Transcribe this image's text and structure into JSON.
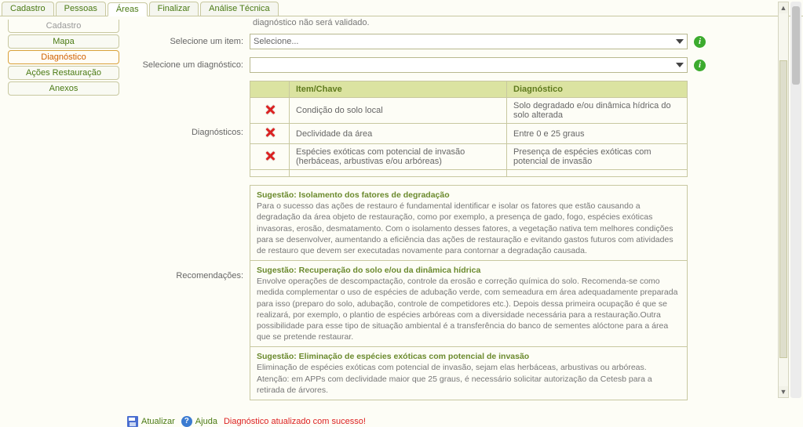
{
  "tabs": [
    {
      "label": "Cadastro",
      "active": false
    },
    {
      "label": "Pessoas",
      "active": false
    },
    {
      "label": "Áreas",
      "active": true
    },
    {
      "label": "Finalizar",
      "active": false
    },
    {
      "label": "Análise Técnica",
      "active": false
    }
  ],
  "sidebar": [
    {
      "label": "Cadastro",
      "state": "dim"
    },
    {
      "label": "Mapa",
      "state": ""
    },
    {
      "label": "Diagnóstico",
      "state": "active"
    },
    {
      "label": "Ações Restauração",
      "state": ""
    },
    {
      "label": "Anexos",
      "state": ""
    }
  ],
  "warning_suffix": "diagnóstico não será validado.",
  "labels": {
    "sel_item": "Selecione um item:",
    "sel_diag": "Selecione um diagnóstico:",
    "diagnosticos": "Diagnósticos:",
    "recomendacoes": "Recomendações:"
  },
  "select_item_value": "Selecione...",
  "select_diag_value": "",
  "diag_headers": {
    "col1": "",
    "col2": "Item/Chave",
    "col3": "Diagnóstico"
  },
  "diag_rows": [
    {
      "item": "Condição do solo local",
      "diag": "Solo degradado e/ou dinâmica hídrica do solo alterada"
    },
    {
      "item": "Declividade da área",
      "diag": "Entre 0 e 25 graus"
    },
    {
      "item": "Espécies exóticas com potencial de invasão (herbáceas, arbustivas e/ou arbóreas)",
      "diag": "Presença de espécies exóticas com potencial de invasão"
    }
  ],
  "recommendations": [
    {
      "title": "Sugestão: Isolamento dos fatores de degradação",
      "body": "Para o sucesso das ações de restauro é fundamental identificar e isolar os fatores que estão causando a degradação da área objeto de restauração, como por exemplo, a presença de gado, fogo, espécies exóticas invasoras, erosão, desmatamento. Com o isolamento desses fatores, a vegetação nativa tem melhores condições para se desenvolver, aumentando a eficiência das ações de restauração e evitando gastos futuros com atividades de restauro que devem ser executadas novamente para contornar a degradação causada."
    },
    {
      "title": "Sugestão: Recuperação do solo e/ou da dinâmica hídrica",
      "body": "Envolve operações de descompactação, controle da erosão e correção química do solo. Recomenda-se como medida complementar o uso de espécies de adubação verde, com semeadura em área adequadamente preparada para isso (preparo do solo, adubação, controle de competidores etc.). Depois dessa primeira ocupação é que se realizará, por exemplo, o plantio de espécies arbóreas com a diversidade necessária para a restauração.Outra possibilidade para esse tipo de situação ambiental é a transferência do banco de sementes alóctone para a área que se pretende restaurar."
    },
    {
      "title": "Sugestão: Eliminação de espécies exóticas com potencial de invasão",
      "body": "Eliminação de espécies exóticas com potencial de invasão, sejam elas herbáceas, arbustivas ou arbóreas. Atenção: em APPs com declividade maior que 25 graus, é necessário solicitar autorização da Cetesb para a retirada de árvores."
    }
  ],
  "actions": {
    "update": "Atualizar",
    "help": "Ajuda",
    "success": "Diagnóstico atualizado com sucesso!"
  }
}
